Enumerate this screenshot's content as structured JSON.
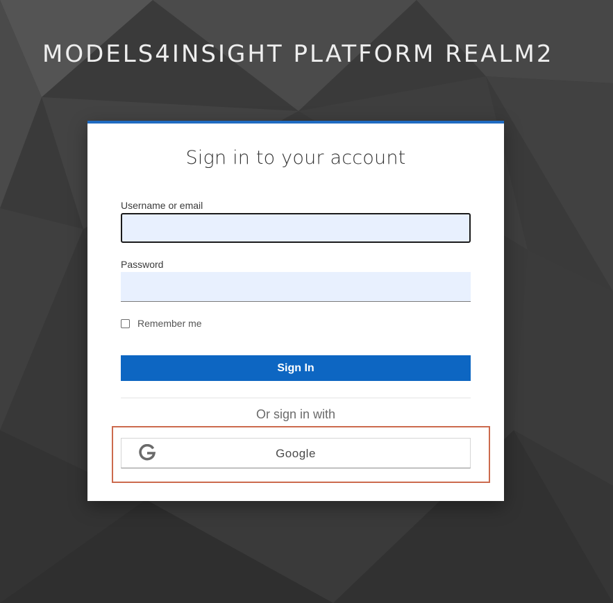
{
  "header": {
    "realm_title": "MODELS4INSIGHT PLATFORM REALM2"
  },
  "login_card": {
    "title": "Sign in to your account",
    "username_label": "Username or email",
    "username_value": "",
    "password_label": "Password",
    "password_value": "",
    "remember_me_label": "Remember me",
    "remember_me_checked": false,
    "sign_in_label": "Sign In",
    "alt_signin_text": "Or sign in with",
    "social_providers": [
      {
        "label": "Google",
        "icon": "google-g-icon"
      }
    ]
  },
  "colors": {
    "accent": "#0d66c2",
    "top_border": "#1f6bc1",
    "input_background": "#e8f0fe",
    "highlight_border": "#cc6a4d",
    "page_background": "#3d3d3d"
  }
}
